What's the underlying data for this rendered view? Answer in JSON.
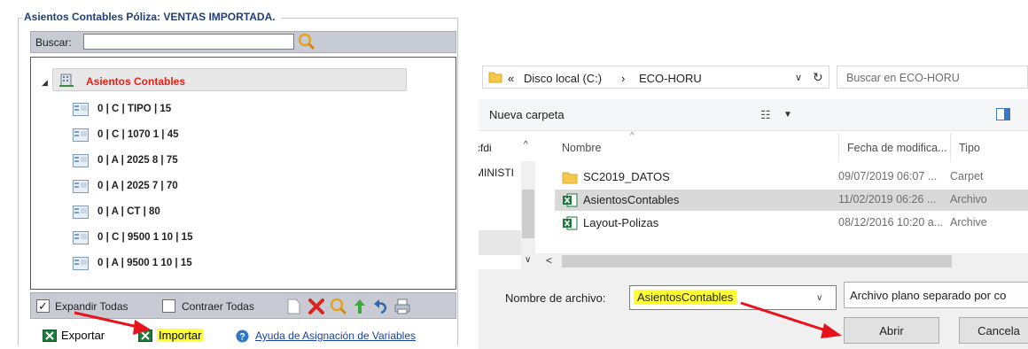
{
  "left_panel": {
    "title": "Asientos Contables Póliza: VENTAS IMPORTADA.",
    "search": {
      "label": "Buscar:",
      "value": ""
    },
    "tree": {
      "root_label": "Asientos Contables",
      "items": [
        "0 | C | TIPO | 15",
        "0 | C | 1070 1 | 45",
        "0 | A | 2025 8 | 75",
        "0 | A | 2025 7 | 70",
        "0 | A | CT | 80",
        "0 | C | 9500 1 10 | 15",
        "0 | A | 9500 1 10 | 15"
      ]
    },
    "bottom_bar": {
      "expand_all": "Expandir Todas",
      "expand_checked": true,
      "collapse_all": "Contraer Todas",
      "collapse_checked": false
    },
    "footer": {
      "export": "Exportar",
      "import": "Importar",
      "help": "Ayuda de Asignación de Variables"
    }
  },
  "file_dialog": {
    "breadcrumb": {
      "prefix": "«",
      "location": "Disco local (C:)",
      "separator": "›",
      "folder": "ECO-HORU"
    },
    "search_placeholder": "Buscar en ECO-HORU",
    "new_folder": "Nueva carpeta",
    "nav_items": [
      "cfdi",
      "MINISTI"
    ],
    "columns": {
      "name": "Nombre",
      "date": "Fecha de modifica...",
      "type": "Tipo"
    },
    "files": [
      {
        "name": "SC2019_DATOS",
        "date": "09/07/2019 06:07 ...",
        "type": "Carpet",
        "icon": "folder-icon",
        "selected": false
      },
      {
        "name": "AsientosContables",
        "date": "11/02/2019 06:26 ...",
        "type": "Archivo",
        "icon": "excel-csv-icon",
        "selected": true
      },
      {
        "name": "Layout-Polizas",
        "date": "08/12/2016 10:20 a...",
        "type": "Archive",
        "icon": "excel-csv-icon",
        "selected": false
      }
    ],
    "filename_label": "Nombre de archivo:",
    "filename_value": "AsientosContables",
    "filetype": "Archivo plano separado por co",
    "open_button": "Abrir",
    "cancel_button": "Cancela"
  },
  "colors": {
    "title_blue": "#1f3f7a",
    "root_red": "#e2231a",
    "highlight_yellow": "#ffff33",
    "arrow_red": "#e8121b",
    "link_blue": "#1a3fa8"
  }
}
